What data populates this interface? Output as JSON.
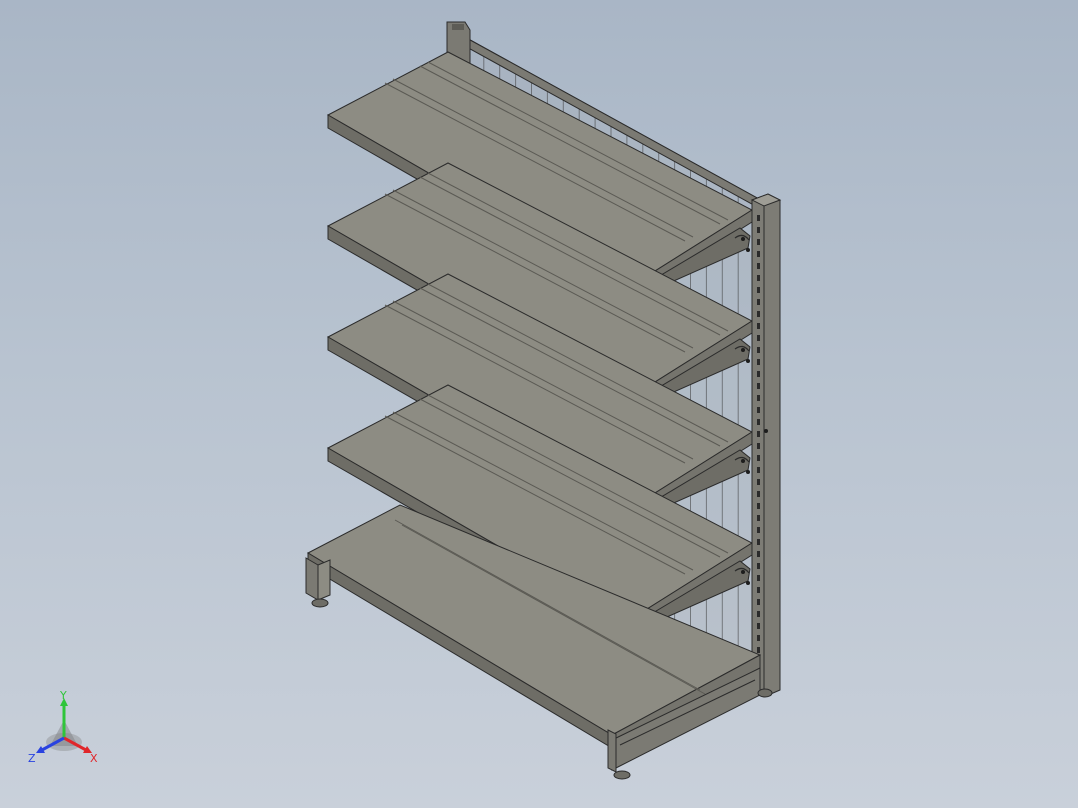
{
  "viewport": {
    "model": "store-shelving-unit",
    "shelf_count": 5,
    "colors": {
      "shelf_top": "#8d8c83",
      "shelf_front": "#6e6d66",
      "frame": "#7b7a73",
      "edge": "#2b2b2b",
      "mesh": "#3a3a3a",
      "background_top": "#a9b6c6",
      "background_bottom": "#c9d0da"
    }
  },
  "triad": {
    "x_label": "X",
    "y_label": "Y",
    "z_label": "Z",
    "x_color": "#e0262a",
    "y_color": "#2fc53a",
    "z_color": "#2a43e0"
  }
}
